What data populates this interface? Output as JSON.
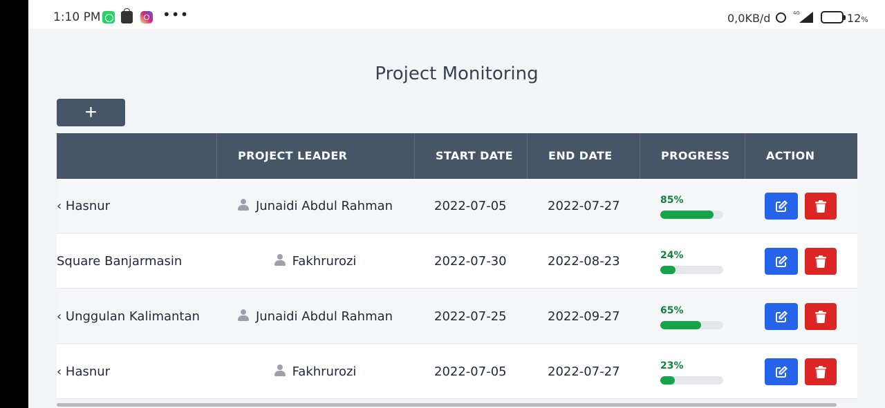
{
  "statusbar": {
    "time": "1:10 PM",
    "more": "•••",
    "network_speed": "0,0KB/d",
    "network_type": "4G",
    "battery_pct": "12",
    "battery_unit": "%"
  },
  "page": {
    "title": "Project Monitoring",
    "add_button_label": "+"
  },
  "table": {
    "columns": [
      "",
      "PROJECT LEADER",
      "START DATE",
      "END DATE",
      "PROGRESS",
      "ACTION"
    ],
    "rows": [
      {
        "project": "‹ Hasnur",
        "leader": "Junaidi Abdul Rahman",
        "start": "2022-07-05",
        "end": "2022-07-27",
        "progress_label": "85%",
        "progress": 85
      },
      {
        "project": " Square Banjarmasin",
        "leader": "Fakhrurozi",
        "start": "2022-07-30",
        "end": "2022-08-23",
        "progress_label": "24%",
        "progress": 24
      },
      {
        "project": "‹ Unggulan Kalimantan",
        "leader": "Junaidi Abdul Rahman",
        "start": "2022-07-25",
        "end": "2022-09-27",
        "progress_label": "65%",
        "progress": 65
      },
      {
        "project": "‹ Hasnur",
        "leader": "Fakhrurozi",
        "start": "2022-07-05",
        "end": "2022-07-27",
        "progress_label": "23%",
        "progress": 23
      }
    ]
  },
  "colors": {
    "header_bg": "#475569",
    "progress_fill": "#16a34a",
    "edit_button": "#2563eb",
    "delete_button": "#dc2626"
  },
  "icons": {
    "leader": "user-icon",
    "edit": "edit-icon",
    "delete": "trash-icon"
  }
}
